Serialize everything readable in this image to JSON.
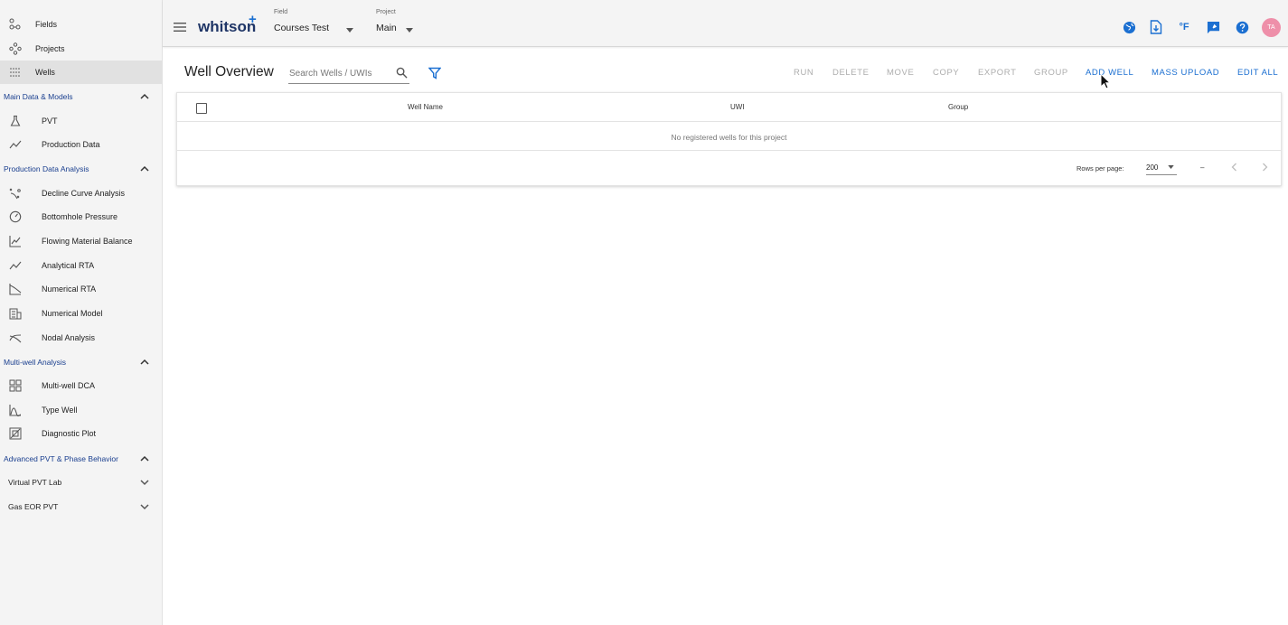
{
  "sidebar": {
    "top_items": [
      {
        "label": "Fields",
        "icon": "fields-icon"
      },
      {
        "label": "Projects",
        "icon": "projects-icon"
      },
      {
        "label": "Wells",
        "icon": "wells-icon",
        "active": true
      }
    ],
    "sections": {
      "main_data": {
        "title": "Main Data & Models",
        "items": [
          {
            "label": "PVT",
            "icon": "flask-icon"
          },
          {
            "label": "Production Data",
            "icon": "trend-line-icon"
          }
        ]
      },
      "production_analysis": {
        "title": "Production Data Analysis",
        "items": [
          {
            "label": "Decline Curve Analysis",
            "icon": "decline-scatter-icon"
          },
          {
            "label": "Bottomhole Pressure",
            "icon": "gauge-icon"
          },
          {
            "label": "Flowing Material Balance",
            "icon": "line-chart-icon"
          },
          {
            "label": "Analytical RTA",
            "icon": "trend-line-icon"
          },
          {
            "label": "Numerical RTA",
            "icon": "decline-chart-icon"
          },
          {
            "label": "Numerical Model",
            "icon": "building-grid-icon"
          },
          {
            "label": "Nodal Analysis",
            "icon": "crossing-lines-icon"
          }
        ]
      },
      "multi_well": {
        "title": "Multi-well Analysis",
        "items": [
          {
            "label": "Multi-well DCA",
            "icon": "grid-squares-icon"
          },
          {
            "label": "Type Well",
            "icon": "bell-curve-icon"
          },
          {
            "label": "Diagnostic Plot",
            "icon": "diagnostic-plot-icon"
          }
        ]
      },
      "advanced": {
        "title": "Advanced PVT & Phase Behavior",
        "items": [
          {
            "label": "Virtual PVT Lab"
          },
          {
            "label": "Gas EOR PVT"
          }
        ]
      }
    }
  },
  "header": {
    "logo": "whitson",
    "logo_plus": "+",
    "field": {
      "caption": "Field",
      "value": "Courses Test"
    },
    "project": {
      "caption": "Project",
      "value": "Main"
    },
    "unit_label": "°F",
    "avatar": "TA"
  },
  "toolbar": {
    "title": "Well Overview",
    "search_placeholder": "Search Wells / UWIs",
    "actions": {
      "run": "RUN",
      "delete": "DELETE",
      "move": "MOVE",
      "copy": "COPY",
      "export": "EXPORT",
      "group": "GROUP",
      "add_well": "ADD WELL",
      "mass_upload": "MASS UPLOAD",
      "edit_all": "EDIT ALL"
    }
  },
  "table": {
    "columns": [
      "Well Name",
      "UWI",
      "Group"
    ],
    "empty_message": "No registered wells for this project",
    "rows_per_page_label": "Rows per page:",
    "rows_per_page": "200",
    "range": "–"
  },
  "colors": {
    "accent": "#1b6fd1",
    "section_title": "#1a3f8f",
    "disabled": "#adadad",
    "avatar_bg": "#ee8fa9",
    "logo": "#1f3566"
  }
}
